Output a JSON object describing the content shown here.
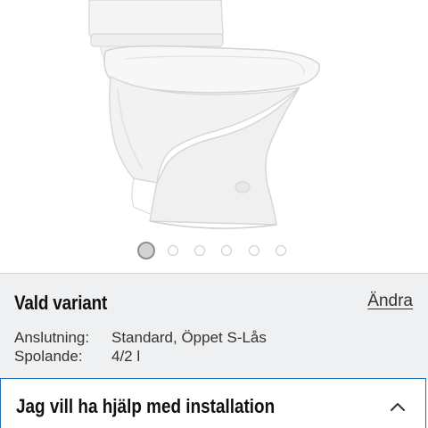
{
  "gallery": {
    "image_alt": "toilet-product-photo",
    "slide_count": 6,
    "active_slide": 1
  },
  "variant": {
    "title": "Vald variant",
    "change_label": "Ändra",
    "specs": [
      {
        "label": "Anslutning:",
        "value": "Standard, Öppet S-Lås"
      },
      {
        "label": "Spolande:",
        "value": "4/2 l"
      }
    ]
  },
  "help": {
    "title": "Jag vill ha hjälp med installation",
    "icon": "chevron-up-icon"
  },
  "colors": {
    "accent_border": "#1b6fb5",
    "panel_bg": "#eef0f1"
  }
}
